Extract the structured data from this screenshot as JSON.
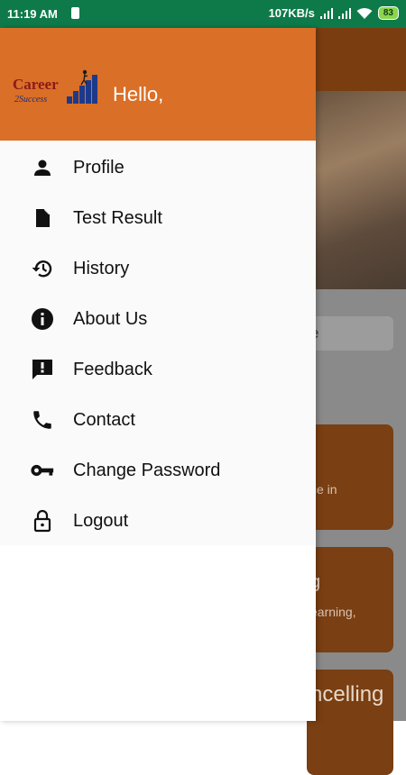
{
  "status_bar": {
    "time": "11:19 AM",
    "net_speed": "107KB/s",
    "battery": "83"
  },
  "drawer": {
    "logo_text_main": "Career",
    "logo_text_sub": "2Success",
    "greeting": "Hello,",
    "items": [
      {
        "label": "Profile",
        "icon": "person-icon"
      },
      {
        "label": "Test Result",
        "icon": "document-icon"
      },
      {
        "label": "History",
        "icon": "history-icon"
      },
      {
        "label": "About Us",
        "icon": "info-icon"
      },
      {
        "label": "Feedback",
        "icon": "feedback-icon"
      },
      {
        "label": "Contact",
        "icon": "phone-icon"
      },
      {
        "label": "Change Password",
        "icon": "key-icon"
      },
      {
        "label": "Logout",
        "icon": "lock-icon"
      }
    ]
  },
  "background": {
    "input_fragment": "e",
    "card1_text": "ce in",
    "card2_title": "g",
    "card2_text": "earning,",
    "card3_title": "ncelling"
  },
  "colors": {
    "status_bar": "#0e7a4a",
    "drawer_header": "#da6f27",
    "accent_dark": "#7a3d10"
  }
}
